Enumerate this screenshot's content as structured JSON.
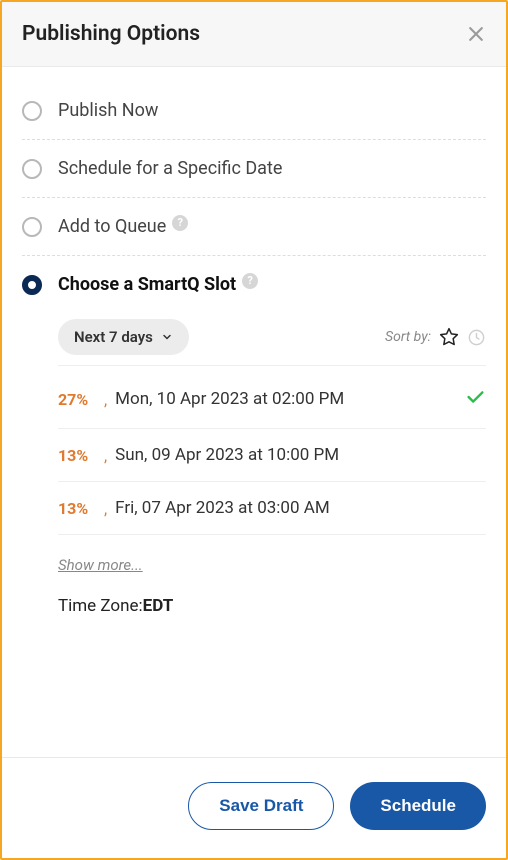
{
  "header": {
    "title": "Publishing Options"
  },
  "options": {
    "publish_now": "Publish Now",
    "schedule_date": "Schedule for a Specific Date",
    "add_to_queue": "Add to Queue",
    "smartq": "Choose a SmartQ Slot",
    "smartq_selected": true
  },
  "smartq": {
    "range": "Next 7 days",
    "sort_by_label": "Sort by:",
    "slots": [
      {
        "pct": "27%",
        "date": "Mon, 10 Apr 2023 at 02:00 PM",
        "selected": true
      },
      {
        "pct": "13%",
        "date": "Sun, 09 Apr 2023 at 10:00 PM",
        "selected": false
      },
      {
        "pct": "13%",
        "date": "Fri, 07 Apr 2023 at 03:00 AM",
        "selected": false
      }
    ],
    "show_more": "Show more...",
    "timezone_label": "Time Zone:",
    "timezone_value": "EDT"
  },
  "footer": {
    "save_draft": "Save Draft",
    "schedule": "Schedule"
  }
}
